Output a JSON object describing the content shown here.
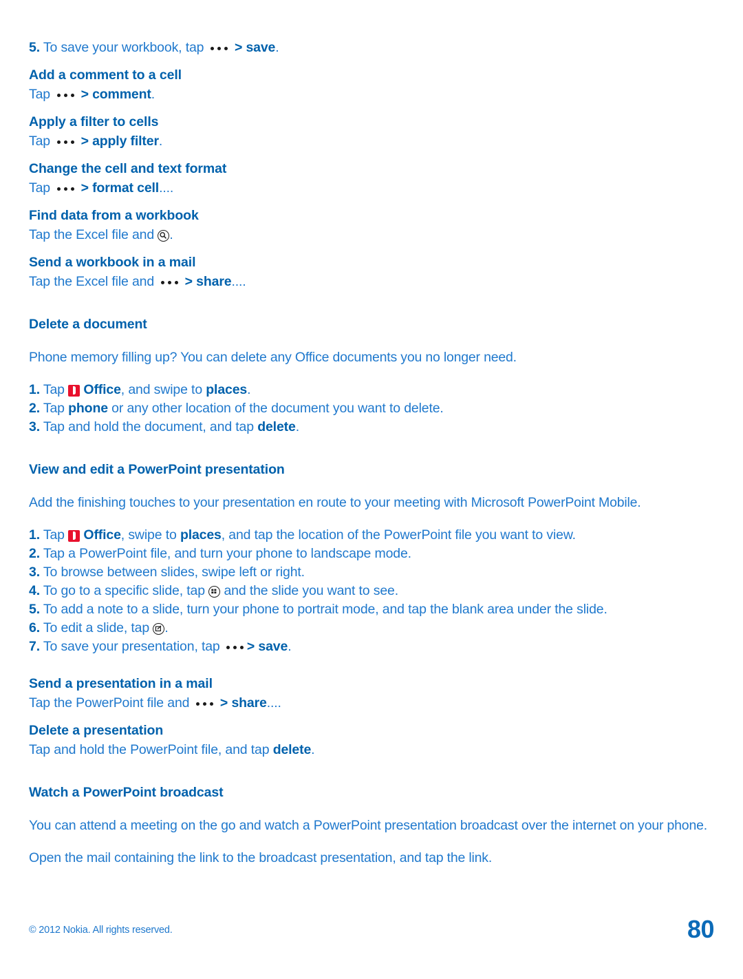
{
  "document": {
    "page_number": "80",
    "copyright": "© 2012 Nokia. All rights reserved.",
    "colors": {
      "heading": "#0061ac",
      "body": "#2079cd",
      "office_icon_red": "#e8112d",
      "dots_icon": "#1a1a1a",
      "page_background": "#ffffff"
    }
  },
  "excel_tail": {
    "step5": {
      "number": "5.",
      "text_before": "To save your workbook, tap",
      "icon": "more-dots-icon",
      "separator": ">",
      "action": "save",
      "period": "."
    },
    "sections": [
      {
        "heading": "Add a comment to a cell",
        "line_before": "Tap",
        "icon": "more-dots-icon",
        "separator": ">",
        "action": "comment",
        "period": "."
      },
      {
        "heading": "Apply a filter to cells",
        "line_before": "Tap",
        "icon": "more-dots-icon",
        "separator": ">",
        "action": "apply filter",
        "period": "."
      },
      {
        "heading": "Change the cell and text format",
        "line_before": "Tap",
        "icon": "more-dots-icon",
        "separator": ">",
        "action": "format cell",
        "period": "...."
      },
      {
        "heading": "Find data from a workbook",
        "line_before": "Tap the Excel file and",
        "icon": "search-circle-icon",
        "separator": "",
        "action": "",
        "period": "."
      },
      {
        "heading": "Send a workbook in a mail",
        "line_before": "Tap the Excel file and",
        "icon": "more-dots-icon",
        "separator": ">",
        "action": "share",
        "period": "...."
      }
    ]
  },
  "delete_document": {
    "heading": "Delete a document",
    "intro": "Phone memory filling up? You can delete any Office documents you no longer need.",
    "steps": [
      {
        "number": "1.",
        "parts": [
          {
            "type": "text",
            "value": "Tap "
          },
          {
            "type": "icon",
            "value": "office-icon"
          },
          {
            "type": "bold",
            "value": " Office"
          },
          {
            "type": "text",
            "value": ", and swipe to "
          },
          {
            "type": "bold",
            "value": "places"
          },
          {
            "type": "text",
            "value": "."
          }
        ]
      },
      {
        "number": "2.",
        "parts": [
          {
            "type": "text",
            "value": "Tap "
          },
          {
            "type": "bold",
            "value": "phone"
          },
          {
            "type": "text",
            "value": " or any other location of the document you want to delete."
          }
        ]
      },
      {
        "number": "3.",
        "parts": [
          {
            "type": "text",
            "value": "Tap and hold the document, and tap "
          },
          {
            "type": "bold",
            "value": "delete"
          },
          {
            "type": "text",
            "value": "."
          }
        ]
      }
    ]
  },
  "powerpoint": {
    "heading": "View and edit a PowerPoint presentation",
    "intro": "Add the finishing touches to your presentation en route to your meeting with Microsoft PowerPoint Mobile.",
    "steps": [
      {
        "number": "1.",
        "parts": [
          {
            "type": "text",
            "value": "Tap "
          },
          {
            "type": "icon",
            "value": "office-icon"
          },
          {
            "type": "bold",
            "value": " Office"
          },
          {
            "type": "text",
            "value": ", swipe to "
          },
          {
            "type": "bold",
            "value": "places"
          },
          {
            "type": "text",
            "value": ", and tap the location of the PowerPoint file you want to view."
          }
        ]
      },
      {
        "number": "2.",
        "parts": [
          {
            "type": "text",
            "value": "Tap a PowerPoint file, and turn your phone to landscape mode."
          }
        ]
      },
      {
        "number": "3.",
        "parts": [
          {
            "type": "text",
            "value": "To browse between slides, swipe left or right."
          }
        ]
      },
      {
        "number": "4.",
        "parts": [
          {
            "type": "text",
            "value": "To go to a specific slide, tap "
          },
          {
            "type": "icon",
            "value": "grid-circle-icon"
          },
          {
            "type": "text",
            "value": " and the slide you want to see."
          }
        ]
      },
      {
        "number": "5.",
        "parts": [
          {
            "type": "text",
            "value": "To add a note to a slide, turn your phone to portrait mode, and tap the blank area under the slide."
          }
        ]
      },
      {
        "number": "6.",
        "parts": [
          {
            "type": "text",
            "value": "To edit a slide, tap "
          },
          {
            "type": "icon",
            "value": "edit-circle-icon"
          },
          {
            "type": "text",
            "value": "."
          }
        ]
      },
      {
        "number": "7.",
        "parts": [
          {
            "type": "text",
            "value": "To save your presentation, tap "
          },
          {
            "type": "icon",
            "value": "more-dots-icon"
          },
          {
            "type": "bold",
            "value": " > save"
          },
          {
            "type": "text",
            "value": "."
          }
        ]
      }
    ]
  },
  "send_presentation": {
    "heading": "Send a presentation in a mail",
    "line_before": "Tap the PowerPoint file and",
    "icon": "more-dots-icon",
    "separator": ">",
    "action": "share",
    "period": "...."
  },
  "delete_presentation": {
    "heading": "Delete a presentation",
    "line_before": "Tap and hold the PowerPoint file, and tap ",
    "action": "delete",
    "period": "."
  },
  "watch_broadcast": {
    "heading": "Watch a PowerPoint broadcast",
    "paragraph1": "You can attend a meeting on the go and watch a PowerPoint presentation broadcast over the internet on your phone.",
    "paragraph2": "Open the mail containing the link to the broadcast presentation, and tap the link."
  }
}
